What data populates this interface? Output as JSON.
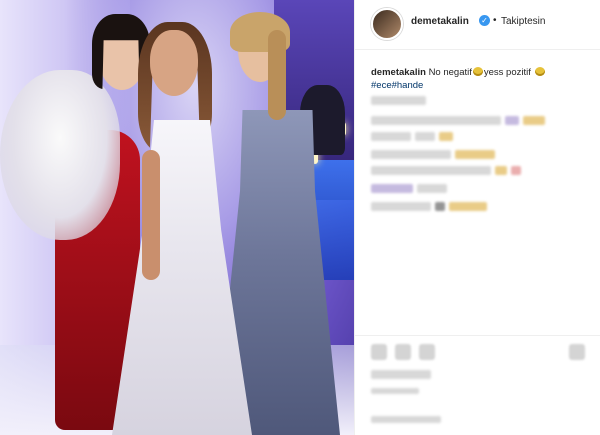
{
  "post": {
    "username": "demetakalin",
    "verified_icon": "verified-badge-icon",
    "separator": "•",
    "follow_status": "Takiptesin",
    "caption": {
      "username": "demetakalin",
      "text_part1": "No negatif",
      "text_part2": "yess pozitif",
      "hashtag1": "#ece",
      "hashtag2": "#hande"
    }
  },
  "colors": {
    "verified": "#3897f0",
    "hashtag": "#003569",
    "text": "#262626"
  }
}
